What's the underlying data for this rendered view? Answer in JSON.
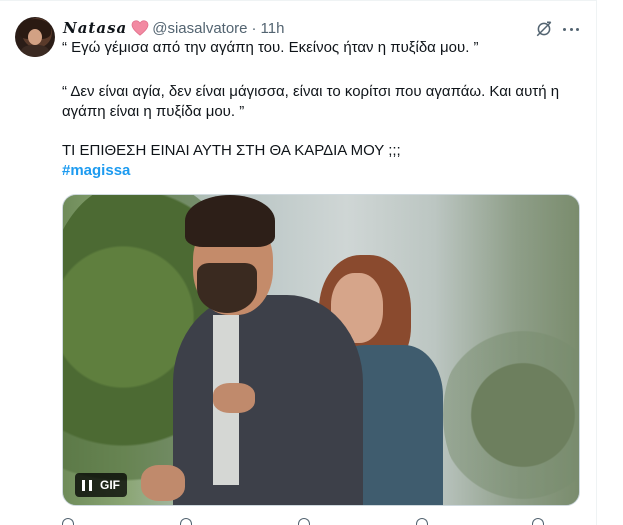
{
  "tweet": {
    "display_name": "Natasa",
    "heart_color": "#f4a3b5",
    "handle": "@siasalvatore",
    "separator": "·",
    "time": "11h",
    "lines": [
      "“ Εγώ γέμισα από την αγάπη του. Εκείνος ήταν η πυξίδα μου. ”",
      "“ Δεν είναι αγία, δεν είναι μάγισσα, είναι το κορίτσι που αγαπάω. Και αυτή η",
      "αγάπη είναι η πυξίδα μου. ”",
      "ΤΙ ΕΠΙΘΕΣΗ ΕΙΝΑΙ ΑΥΤΗ ΣΤΗ ΘΑ ΚΑΡΔΙΑ ΜΟΥ ;;;"
    ],
    "hashtag": "#magissa",
    "media": {
      "badge": "GIF"
    }
  },
  "icons": {
    "avatar": "user-avatar",
    "heart": "heart-icon",
    "grok": "grok-icon",
    "more": "more-icon",
    "pause": "pause-icon"
  },
  "colors": {
    "link": "#1d9bf0",
    "secondary_text": "#536471",
    "border": "#eff3f4"
  }
}
